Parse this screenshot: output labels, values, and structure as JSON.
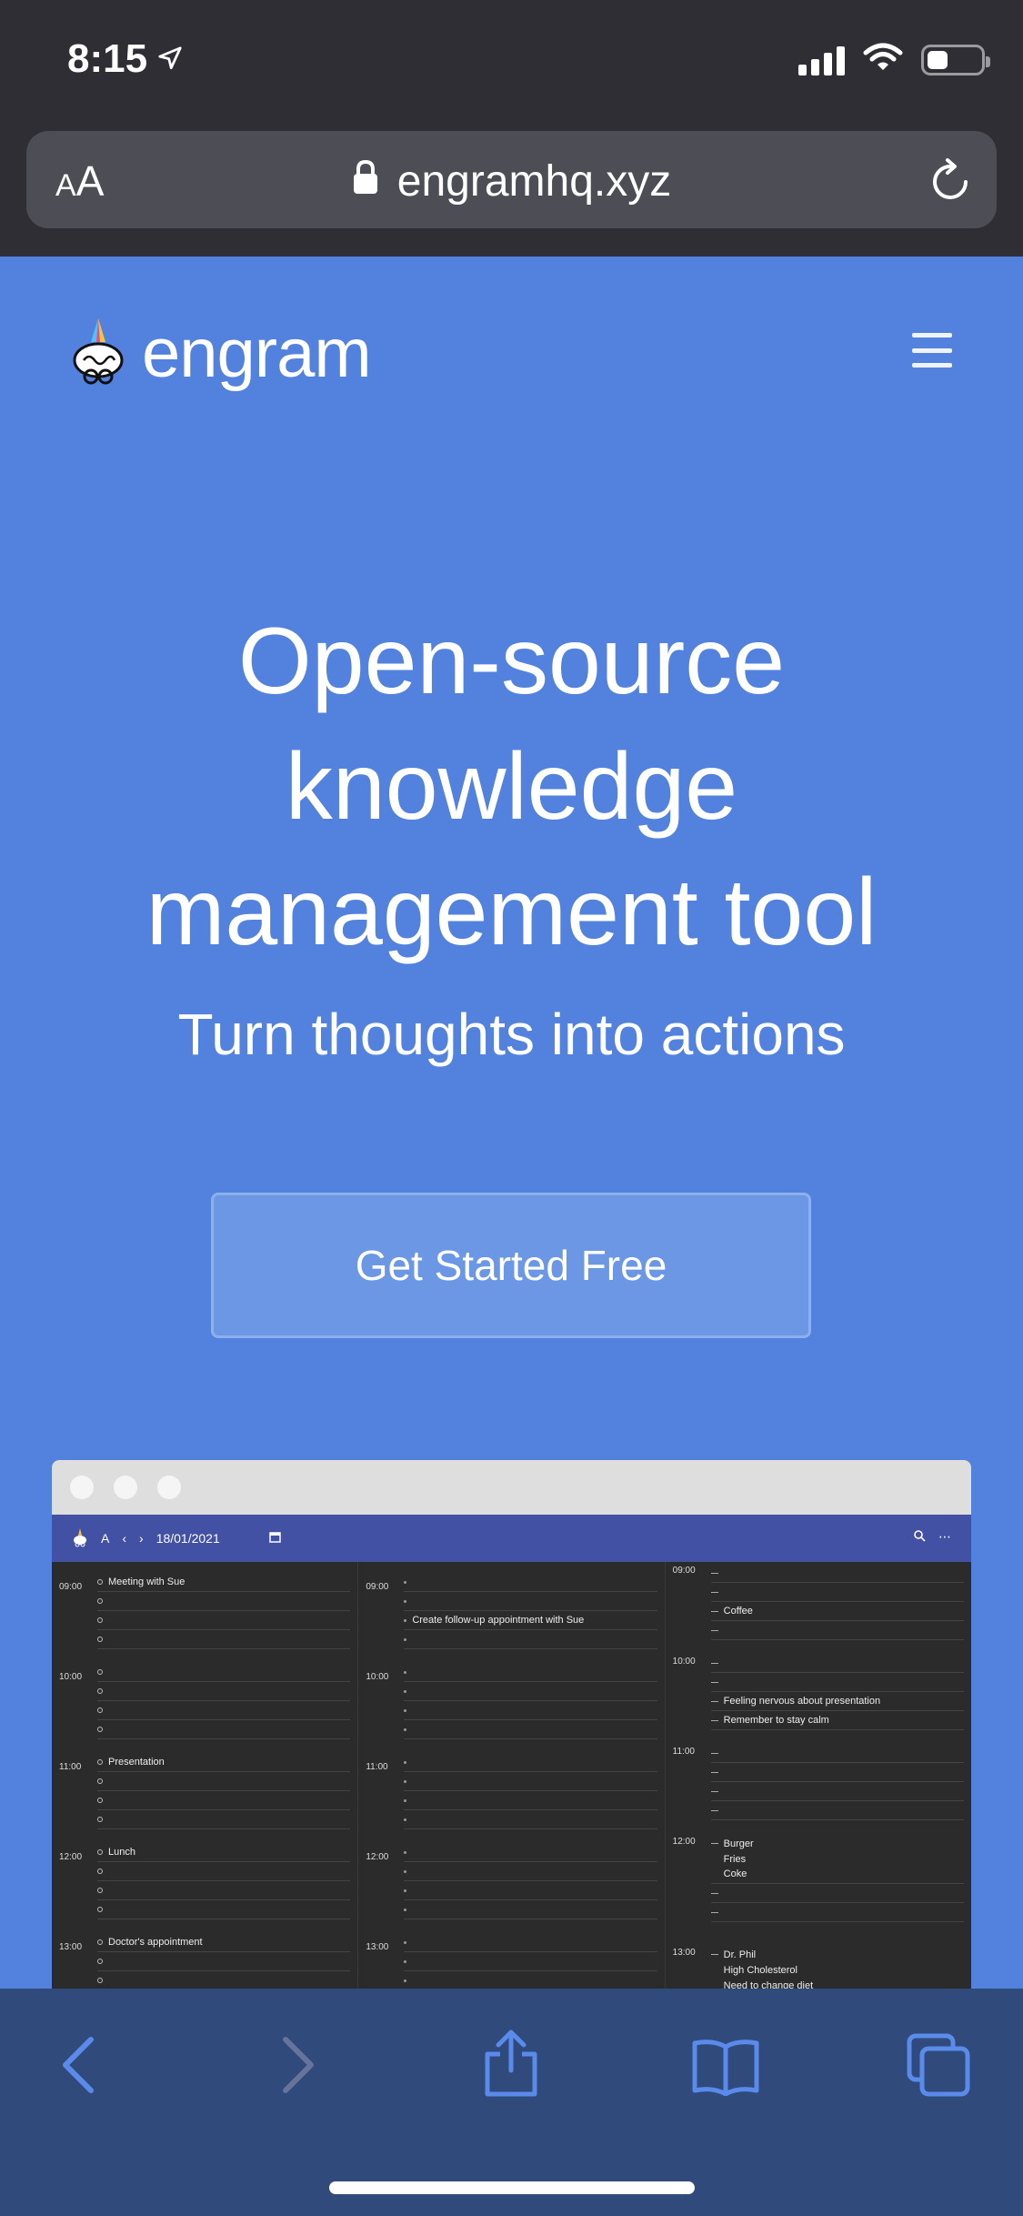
{
  "status_bar": {
    "time": "8:15"
  },
  "url_bar": {
    "text_size_label": "AA",
    "domain": "engramhq.xyz"
  },
  "site": {
    "brand": "engram",
    "hero_title_lines": [
      "Open-source",
      "knowledge",
      "management tool"
    ],
    "hero_subtitle": "Turn thoughts into actions",
    "cta_label": "Get Started Free"
  },
  "preview": {
    "toolbar_letter": "A",
    "toolbar_date": "18/01/2021",
    "col1": {
      "hours": [
        "09:00",
        "10:00",
        "11:00",
        "12:00",
        "13:00"
      ],
      "items": [
        "Meeting with Sue",
        "Presentation",
        "Lunch",
        "Doctor's appointment"
      ]
    },
    "col2": {
      "hours": [
        "09:00",
        "10:00",
        "11:00",
        "12:00",
        "13:00"
      ],
      "items": [
        "Create follow-up appointment with Sue"
      ]
    },
    "col3": {
      "hours": [
        "09:00",
        "10:00",
        "11:00",
        "12:00",
        "13:00"
      ],
      "items": [
        "Coffee",
        "Feeling nervous about presentation",
        "Remember to stay calm",
        "Burger",
        "Fries",
        "Coke",
        "Dr. Phil",
        "High Cholesterol",
        "Need to change diet"
      ]
    }
  },
  "icons": {
    "location": "location-arrow-icon",
    "wifi": "wifi-icon",
    "lock": "lock-icon",
    "reload": "reload-icon",
    "menu": "hamburger-menu-icon",
    "back": "chevron-left-icon",
    "forward": "chevron-right-icon",
    "share": "share-icon",
    "bookmarks": "book-icon",
    "tabs": "tabs-icon"
  },
  "colors": {
    "page_bg": "#5282DE",
    "top_bar": "#2E2E34",
    "bottom_bar": "#304A7C",
    "cta_bg": "#6B97E4",
    "preview_toolbar": "#4351A5"
  }
}
